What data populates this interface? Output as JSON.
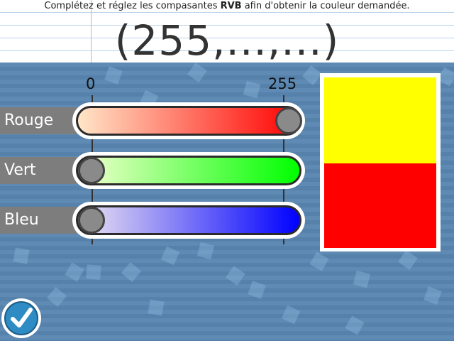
{
  "header": {
    "instruction_pre": "Complétez et réglez les compasantes ",
    "instruction_bold": "RVB",
    "instruction_post": " afin d'obtenir la couleur demandée.",
    "target_code": "(255,...,...)"
  },
  "scale": {
    "min_label": "0",
    "max_label": "255"
  },
  "sliders": [
    {
      "label": "Rouge",
      "value": 255,
      "max": 255,
      "gradient_start": "#ffe6c8",
      "gradient_end": "#ff0000"
    },
    {
      "label": "Vert",
      "value": 0,
      "max": 255,
      "gradient_start": "#f5ffd0",
      "gradient_end": "#00ff00"
    },
    {
      "label": "Bleu",
      "value": 0,
      "max": 255,
      "gradient_start": "#efe6f0",
      "gradient_end": "#0000ff"
    }
  ],
  "swatch": {
    "target_color": "#ffff00",
    "current_color": "#ff0000"
  },
  "submit": {
    "icon": "checkmark-icon"
  },
  "colors": {
    "board": "#5b87b1",
    "label_bg": "#7d7d7d",
    "button": "#2e8bc3"
  }
}
